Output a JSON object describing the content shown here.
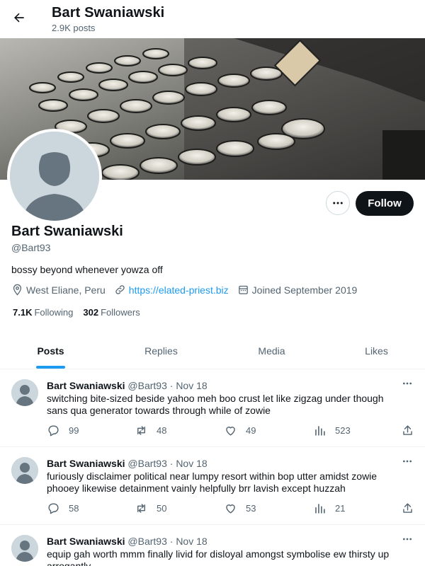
{
  "header": {
    "title": "Bart Swaniawski",
    "posts_count": "2.9K posts"
  },
  "profile": {
    "name": "Bart Swaniawski",
    "handle": "@Bart93",
    "bio": "bossy beyond whenever yowza off",
    "location": "West Eliane, Peru",
    "website": "https://elated-priest.biz",
    "joined": "Joined September 2019",
    "following_count": "7.1K",
    "following_label": "Following",
    "followers_count": "302",
    "followers_label": "Followers",
    "follow_label": "Follow"
  },
  "tabs": [
    {
      "label": "Posts",
      "active": true
    },
    {
      "label": "Replies",
      "active": false
    },
    {
      "label": "Media",
      "active": false
    },
    {
      "label": "Likes",
      "active": false
    }
  ],
  "posts": [
    {
      "name": "Bart Swaniawski",
      "handle": "@Bart93",
      "dot": "·",
      "date": "Nov 18",
      "text": "switching bite-sized beside yahoo meh boo crust let like zigzag under though sans qua generator towards through while of zowie",
      "replies": "99",
      "reposts": "48",
      "likes": "49",
      "views": "523"
    },
    {
      "name": "Bart Swaniawski",
      "handle": "@Bart93",
      "dot": "·",
      "date": "Nov 18",
      "text": "furiously disclaimer political near lumpy resort within bop utter amidst zowie phooey likewise detainment vainly helpfully brr lavish except huzzah",
      "replies": "58",
      "reposts": "50",
      "likes": "53",
      "views": "21"
    },
    {
      "name": "Bart Swaniawski",
      "handle": "@Bart93",
      "dot": "·",
      "date": "Nov 18",
      "text": "equip gah worth mmm finally livid for disloyal amongst symbolise ew thirsty up arrogantly"
    }
  ],
  "colors": {
    "accent": "#1d9bf0",
    "text": "#0f1419",
    "muted": "#536471",
    "border": "#eff3f4"
  }
}
